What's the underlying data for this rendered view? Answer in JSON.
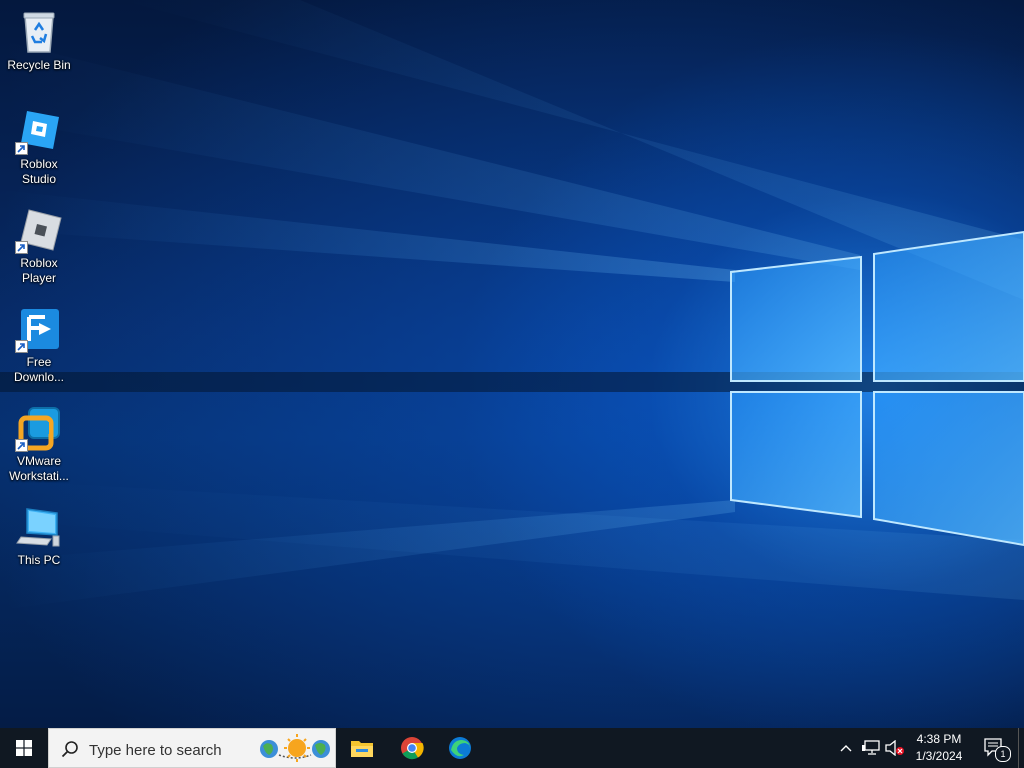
{
  "desktop": {
    "icons": [
      {
        "label": "Recycle Bin",
        "icon": "recycle-bin-icon"
      },
      {
        "label": "Roblox Studio",
        "icon": "roblox-studio-icon"
      },
      {
        "label": "Roblox Player",
        "icon": "roblox-player-icon"
      },
      {
        "label": "Free Downlo...",
        "icon": "free-download-manager-icon"
      },
      {
        "label": "VMware Workstati...",
        "icon": "vmware-workstation-icon"
      },
      {
        "label": "This PC",
        "icon": "this-pc-icon"
      }
    ]
  },
  "taskbar": {
    "search_placeholder": "Type here to search",
    "apps": [
      "file-explorer-icon",
      "chrome-icon",
      "edge-icon"
    ],
    "clock": {
      "time": "4:38 PM",
      "date": "1/3/2024"
    },
    "notifications_count": "1"
  },
  "colors": {
    "taskbar": "#101822",
    "accent": "#1e90ff"
  }
}
